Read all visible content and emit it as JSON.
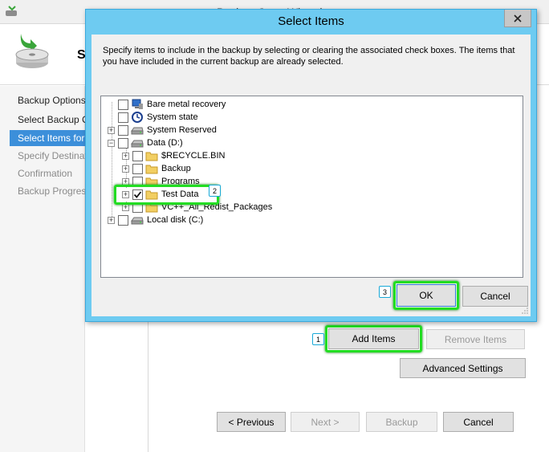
{
  "background_window": {
    "title": "Backup Once Wizard",
    "header_title": "S",
    "steps": [
      {
        "label": "Backup Options",
        "state": "normal"
      },
      {
        "label": "Select Backup Configuration",
        "state": "normal"
      },
      {
        "label": "Select Items for Backup",
        "state": "current"
      },
      {
        "label": "Specify Destination Type",
        "state": "disabled"
      },
      {
        "label": "Confirmation",
        "state": "disabled"
      },
      {
        "label": "Backup Progress",
        "state": "disabled"
      }
    ],
    "buttons": {
      "add_items": "Add Items",
      "remove_items": "Remove Items",
      "advanced_settings": "Advanced Settings",
      "previous": "< Previous",
      "next": "Next >",
      "backup": "Backup",
      "cancel": "Cancel"
    }
  },
  "dialog": {
    "title": "Select Items",
    "instructions": "Specify items to include in the backup by selecting or clearing the associated check boxes. The items that you have included in the current backup are already selected.",
    "tree": [
      {
        "label": "Bare metal recovery",
        "icon": "computer-icon",
        "checked": false,
        "expander": false,
        "level": 0
      },
      {
        "label": "System state",
        "icon": "clock-icon",
        "checked": false,
        "expander": false,
        "level": 0
      },
      {
        "label": "System Reserved",
        "icon": "drive-icon",
        "checked": false,
        "expander": "plus",
        "level": 0
      },
      {
        "label": "Data (D:)",
        "icon": "drive-icon",
        "checked": false,
        "expander": "minus",
        "level": 0
      },
      {
        "label": "$RECYCLE.BIN",
        "icon": "folder-icon",
        "checked": false,
        "expander": "plus",
        "level": 1
      },
      {
        "label": "Backup",
        "icon": "folder-icon",
        "checked": false,
        "expander": "plus",
        "level": 1
      },
      {
        "label": "Programs",
        "icon": "folder-icon",
        "checked": false,
        "expander": "plus",
        "level": 1
      },
      {
        "label": "Test Data",
        "icon": "folder-icon",
        "checked": true,
        "expander": "plus",
        "level": 1
      },
      {
        "label": "VC++_All_Redist_Packages",
        "icon": "folder-icon",
        "checked": false,
        "expander": "plus",
        "level": 1
      },
      {
        "label": "Local disk (C:)",
        "icon": "drive-icon",
        "checked": false,
        "expander": "plus",
        "level": 0
      }
    ],
    "ok_label": "OK",
    "cancel_label": "Cancel",
    "close_icon": "close-icon"
  },
  "callouts": {
    "one": "1",
    "two": "2",
    "three": "3"
  },
  "colors": {
    "dialog_frame": "#6ecbf1",
    "highlight": "#22dd22",
    "selected_step": "#3c8fda",
    "callout_border": "#19a9d8"
  }
}
